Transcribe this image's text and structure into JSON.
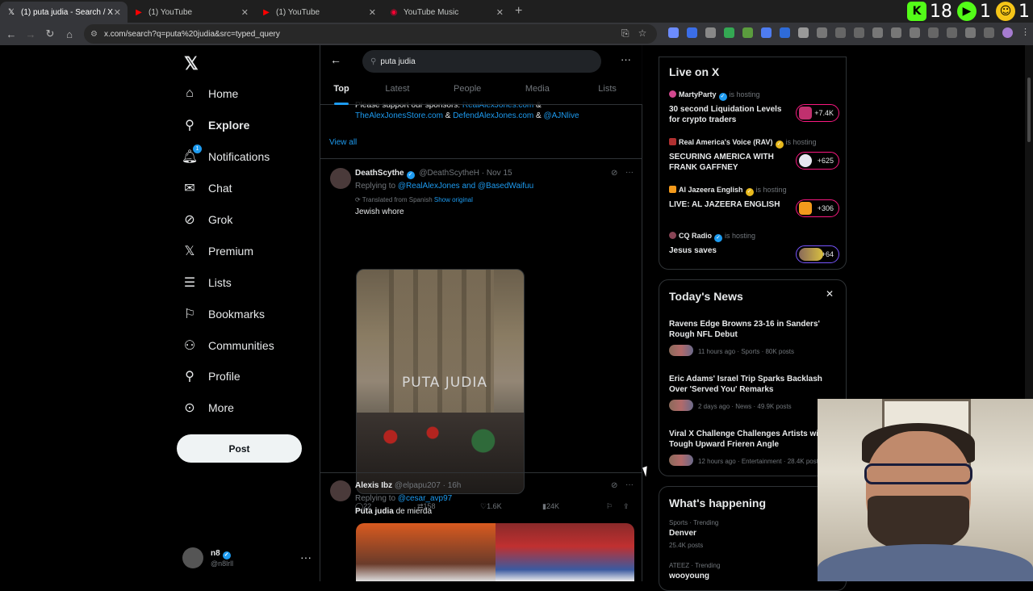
{
  "browser": {
    "tabs": [
      {
        "title": "(1) puta judia - Search / X",
        "icon": "x-logo-icon"
      },
      {
        "title": "(1) YouTube",
        "icon": "youtube-icon"
      },
      {
        "title": "(1) YouTube",
        "icon": "youtube-icon"
      },
      {
        "title": "YouTube Music",
        "icon": "youtube-music-icon"
      }
    ],
    "url": "x.com/search?q=puta%20judia&src=typed_query",
    "stream_badges": {
      "kick_count": "18",
      "play_count": "1",
      "end": "1"
    }
  },
  "nav": {
    "items": [
      {
        "label": "Home",
        "icon": "home-icon"
      },
      {
        "label": "Explore",
        "icon": "search-icon"
      },
      {
        "label": "Notifications",
        "icon": "bell-icon",
        "badge": "1"
      },
      {
        "label": "Chat",
        "icon": "mail-icon"
      },
      {
        "label": "Grok",
        "icon": "grok-icon"
      },
      {
        "label": "Premium",
        "icon": "x-premium-icon"
      },
      {
        "label": "Lists",
        "icon": "list-icon"
      },
      {
        "label": "Bookmarks",
        "icon": "bookmark-icon"
      },
      {
        "label": "Communities",
        "icon": "people-icon"
      },
      {
        "label": "Profile",
        "icon": "person-icon"
      },
      {
        "label": "More",
        "icon": "more-circle-icon"
      }
    ],
    "post_label": "Post",
    "account": {
      "name": "n8",
      "handle": "@n8lrll"
    }
  },
  "search": {
    "query": "puta judia",
    "tabs": [
      "Top",
      "Latest",
      "People",
      "Media",
      "Lists"
    ],
    "active_tab": "Top"
  },
  "feed": {
    "sponsor_prefix": "Please support our sponsors:",
    "sponsor_link1": "RealAlexJones.com",
    "sponsor_link2": "TheAlexJonesStore.com",
    "sponsor_link3": "DefendAlexJones.com",
    "sponsor_link4": "@AJNlive",
    "amp": "&",
    "view_all": "View all",
    "tweet1": {
      "name": "DeathScythe",
      "handle": "@DeathScytheH",
      "date": "Nov 15",
      "replying_prefix": "Replying to",
      "replying_to": "@RealAlexJones and @BasedWaifuu",
      "translated": "Translated from Spanish",
      "show_original": "Show original",
      "text": "Jewish whore",
      "image_text": "PUTA JUDIA",
      "replies": "22",
      "reposts": "158",
      "likes": "1.6K",
      "views": "24K"
    },
    "tweet2": {
      "name": "Alexis Ibz",
      "handle": "@elpapu207",
      "date": "16h",
      "replying_prefix": "Replying to",
      "replying_to": "@cesar_avp97",
      "text_bold": "Puta judia",
      "text_rest": "de mierda"
    }
  },
  "live": {
    "title": "Live on X",
    "hosting": "is hosting",
    "spaces": [
      {
        "host": "MartyParty",
        "title": "30 second Liquidation Levels for crypto traders",
        "count": "+7.4K"
      },
      {
        "host": "Real America's Voice (RAV)",
        "title": "SECURING AMERICA WITH FRANK GAFFNEY",
        "count": "+625"
      },
      {
        "host": "Al Jazeera English",
        "title": "LIVE: AL JAZEERA ENGLISH",
        "count": "+306"
      },
      {
        "host": "CQ Radio",
        "title": "Jesus saves",
        "count": "+64"
      }
    ]
  },
  "news": {
    "title": "Today's News",
    "items": [
      {
        "title": "Ravens Edge Browns 23-16 in Sanders' Rough NFL Debut",
        "meta": "11 hours ago · Sports · 80K posts"
      },
      {
        "title": "Eric Adams' Israel Trip Sparks Backlash Over 'Served You' Remarks",
        "meta": "2 days ago · News · 49.9K posts"
      },
      {
        "title": "Viral X Challenge Challenges Artists with Tough Upward Frieren Angle",
        "meta": "12 hours ago · Entertainment · 28.4K posts"
      }
    ]
  },
  "happening": {
    "title": "What's happening",
    "items": [
      {
        "category": "Sports · Trending",
        "name": "Denver",
        "count": "25.4K posts"
      },
      {
        "category": "ATEEZ · Trending",
        "name": "wooyoung",
        "count": ""
      }
    ]
  },
  "colors": {
    "accent": "#1d9bf0",
    "background": "#000000",
    "border": "#2f3336",
    "muted": "#71767b",
    "live_pink": "#f91880"
  }
}
